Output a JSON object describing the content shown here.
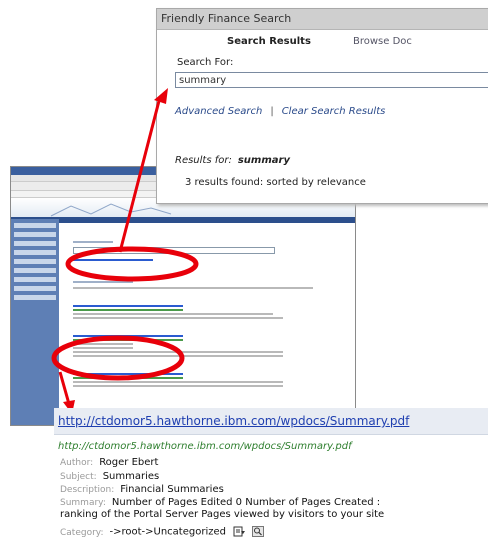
{
  "top_panel": {
    "window_title": "Friendly Finance Search",
    "tab_search_results": "Search Results",
    "tab_browse": "Browse Doc",
    "search_for_label": "Search For:",
    "search_value": "summary",
    "advanced_search_link": "Advanced Search",
    "separator": "|",
    "clear_results_link": "Clear Search Results",
    "results_for_label": "Results for:",
    "results_for_term": "summary",
    "results_found": "3  results found:  sorted by relevance"
  },
  "bottom_panel": {
    "result_title": "http://ctdomor5.hawthorne.ibm.com/wpdocs/Summary.pdf",
    "result_url": "http://ctdomor5.hawthorne.ibm.com/wpdocs/Summary.pdf",
    "author_label": "Author:",
    "author_value": "Roger Ebert",
    "subject_label": "Subject:",
    "subject_value": "Summaries",
    "description_label": "Description:",
    "description_value": "Financial Summaries",
    "summary_label": "Summary:",
    "summary_line1": "Number of Pages Edited 0 Number of Pages Created :",
    "summary_line2": "ranking of the Portal Server Pages viewed by visitors to your site",
    "category_label": "Category:",
    "category_value": "->root->Uncategorized",
    "icons": [
      "document-icon",
      "magnifier-icon"
    ]
  },
  "colors": {
    "annotation_red": "#e8000a",
    "link_blue": "#1f3fb0",
    "url_green": "#2f7f2f",
    "nav_blue": "#5e7fb5"
  }
}
